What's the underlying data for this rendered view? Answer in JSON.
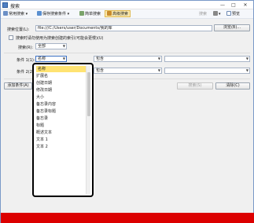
{
  "window": {
    "title": "搜索",
    "minimize": "—",
    "maximize": "□",
    "close": "✕"
  },
  "toolbar": {
    "common_search": "常用搜索",
    "save_search_conditions": "保存搜索条件",
    "simple_search": "简单搜索",
    "advanced_search": "高级搜索",
    "search_disabled": "搜索",
    "preview": "预览"
  },
  "form": {
    "location_label": "搜索位置(L):",
    "location_value": "file:///C:/Users/user/Documents/我的库",
    "browse_button": "浏览(B)...",
    "index_checkbox_label": "搜索时请勿使用为搜索创建的索引(可能会更慢)(U)",
    "search_label": "搜索(R):",
    "search_value": "全部",
    "condition1_label": "条件 1(1):",
    "condition1_field": "名称",
    "condition1_op": "包含",
    "condition2_label": "条件 2(2):",
    "condition2_op": "包含",
    "add_condition_button": "添加条件(A)",
    "search_button": "搜索(S)",
    "clear_button": "清除(C)"
  },
  "dropdown": {
    "items": [
      "名称",
      "扩展名",
      "创建日期",
      "修改日期",
      "大小",
      "备忘录内容",
      "备忘录标题",
      "备忘录",
      "标题",
      "概述文本",
      "文本 1",
      "文本 2"
    ],
    "selected_index": 0
  },
  "colors": {
    "accent": "#3d72c6",
    "selected_item": "#ffe372",
    "status_bar": "#dc0000"
  }
}
